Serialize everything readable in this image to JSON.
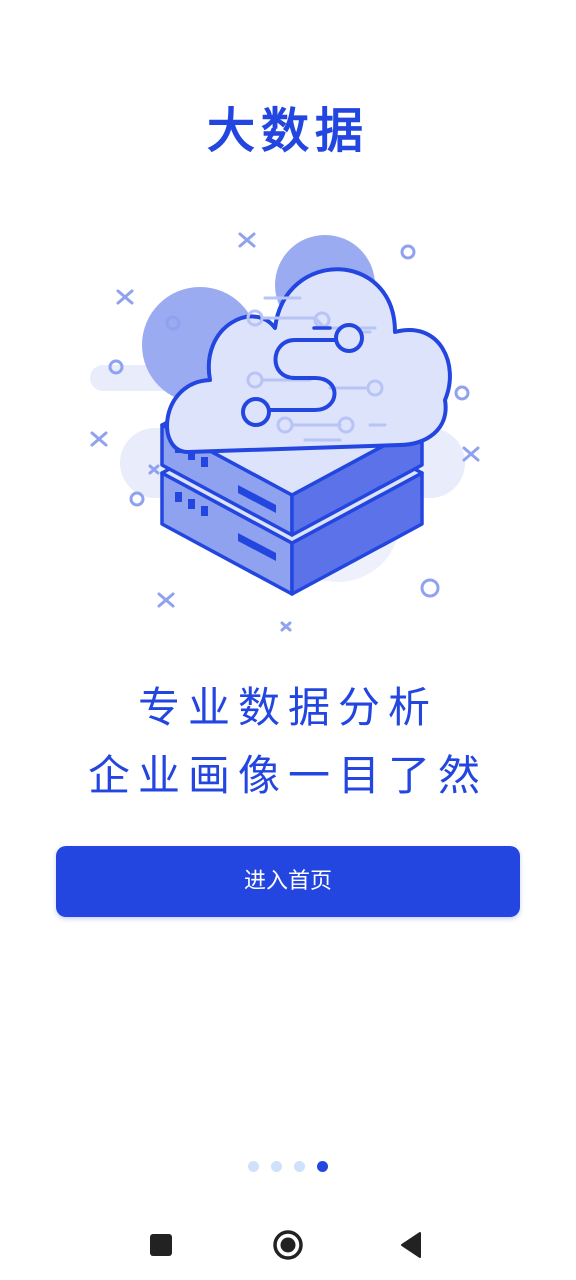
{
  "header": {
    "title": "大数据"
  },
  "illustration": {
    "icon": "cloud-server-icon",
    "colors": {
      "primary": "#2346e0",
      "light": "#dde3fb",
      "medium": "#8fa2ef",
      "background": "#e8ecfb"
    }
  },
  "slogan": {
    "line1": "专业数据分析",
    "line2": "企业画像一目了然"
  },
  "actions": {
    "enter_label": "进入首页"
  },
  "pager": {
    "total": 4,
    "current": 4
  },
  "system_nav": {
    "recents_icon": "square-icon",
    "home_icon": "circle-icon",
    "back_icon": "triangle-back-icon"
  },
  "colors": {
    "accent": "#2346e0",
    "dot_inactive": "#cfe1fb"
  }
}
